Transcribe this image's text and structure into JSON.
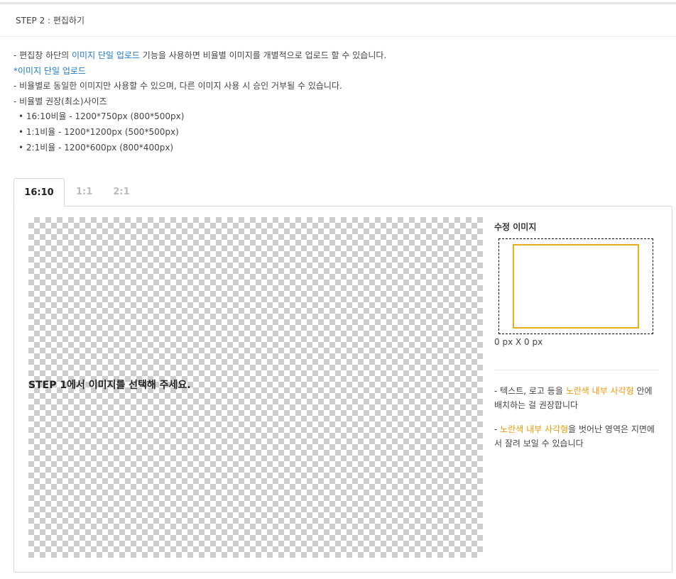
{
  "header": {
    "title": "STEP 2 : 편집하기"
  },
  "guide": {
    "line1_prefix": "- 편집창 하단의 ",
    "line1_highlight": "이미지 단일 업로드",
    "line1_suffix": " 기능을 사용하면 비율별 이미지를 개별적으로 업로드 할 수 있습니다.",
    "line2": "*이미지 단일 업로드",
    "line3": "- 비율별로 동일한 이미지만 사용할 수 있으며, 다른 이미지 사용 시 승인 거부될 수 있습니다.",
    "line4": "- 비율별 권장(최소)사이즈",
    "sizes": [
      "• 16:10비율 - 1200*750px (800*500px)",
      "• 1:1비율 - 1200*1200px (500*500px)",
      "• 2:1비율 - 1200*600px (800*400px)"
    ]
  },
  "tabs": [
    {
      "label": "16:10",
      "active": true
    },
    {
      "label": "1:1",
      "active": false
    },
    {
      "label": "2:1",
      "active": false
    }
  ],
  "editor": {
    "canvas_message": "STEP 1에서 이미지를 선택해 주세요.",
    "preview_title": "수정 이미지",
    "size_readout": "0 px X 0 px",
    "note1_prefix": "- 텍스트, 로고 등을 ",
    "note1_highlight": "노란색 내부 사각형",
    "note1_suffix": " 안에 배치하는 걸 권장합니다",
    "note2_prefix": "- ",
    "note2_highlight": "노란색 내부 사각형",
    "note2_suffix": "을 벗어난 영역은 지면에서 잘려 보일 수 있습니다"
  },
  "colors": {
    "link_blue": "#1f7bc6",
    "highlight_orange": "#ee9a0a",
    "safe_area_border": "#e7ad1a"
  }
}
